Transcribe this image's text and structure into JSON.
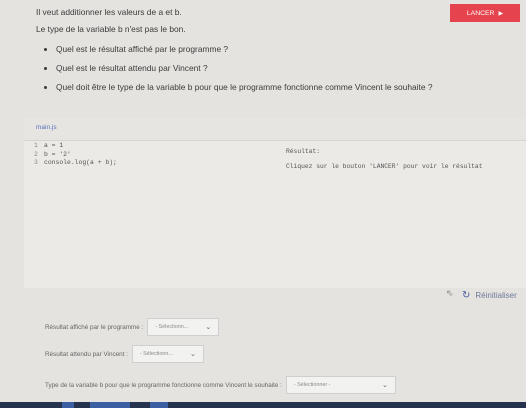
{
  "instructions": {
    "line1": "Il veut additionner les valeurs de a et b.",
    "line2": "Le type de la variable b n'est pas le bon.",
    "bullets": [
      "Quel est le résultat affiché par le programme ?",
      "Quel est le résultat attendu par Vincent ?",
      "Quel doit être le type de la variable b pour que le programme fonctionne comme Vincent le souhaite ?"
    ]
  },
  "editor": {
    "file_tab": "main.js",
    "run_label": "LANCER",
    "lines": [
      {
        "num": "1",
        "code": "a = 1"
      },
      {
        "num": "2",
        "code": "b = '2'"
      },
      {
        "num": "3",
        "code": "console.log(a + b);"
      }
    ]
  },
  "output": {
    "label": "Résultat:",
    "message": "Cliquez sur le bouton 'LANCER' pour voir le résultat"
  },
  "reset_label": "Réinitialiser",
  "questions": [
    {
      "label": "Résultat affiché par le programme :",
      "placeholder": "- Sélectionn..."
    },
    {
      "label": "Résultat attendu par Vincent :",
      "placeholder": "- Sélectionn..."
    },
    {
      "label": "Type de la variable b pour que le programme fonctionne comme Vincent le souhaite :",
      "placeholder": "- Sélectionner -"
    }
  ],
  "colors": {
    "run_button": "#e5434d",
    "file_tab": "#5a6fbd",
    "taskbar": "#26334f"
  }
}
